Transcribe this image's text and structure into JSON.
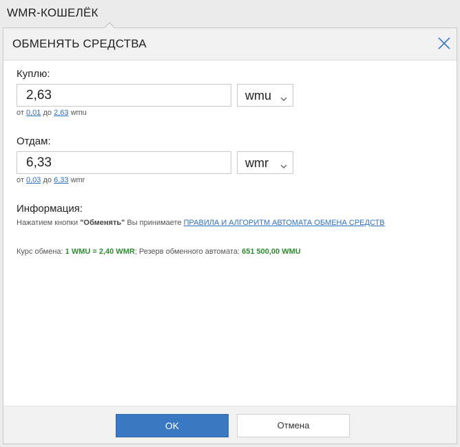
{
  "app": {
    "title": "WMR-КОШЕЛЁК"
  },
  "dialog": {
    "title": "ОБМЕНЯТЬ СРЕДСТВА",
    "buy": {
      "label": "Куплю:",
      "value": "2,63",
      "currency": "wmu",
      "range_from_text": "от",
      "range_min": "0,01",
      "range_to_text": "до",
      "range_max": "2,63",
      "range_unit": "wmu"
    },
    "give": {
      "label": "Отдам:",
      "value": "6,33",
      "currency": "wmr",
      "range_from_text": "от",
      "range_min": "0,03",
      "range_to_text": "до",
      "range_max": "6,33",
      "range_unit": "wmr"
    },
    "info": {
      "title": "Информация:",
      "text_prefix": "Нажатием кнопки",
      "button_name": "\"Обменять\"",
      "text_middle": "Вы принимаете",
      "rules_link": "ПРАВИЛА И АЛГОРИТМ АВТОМАТА ОБМЕНА СРЕДСТВ",
      "rate_label": "Курс обмена:",
      "rate_value": "1 WMU = 2,40 WMR",
      "reserve_label": "; Резерв обменного автомата:",
      "reserve_value": "651 500,00 WMU"
    },
    "buttons": {
      "ok": "OK",
      "cancel": "Отмена"
    }
  },
  "colors": {
    "accent": "#3b78c4",
    "link": "#2c6fbe",
    "highlight_green": "#2e8b2e"
  }
}
